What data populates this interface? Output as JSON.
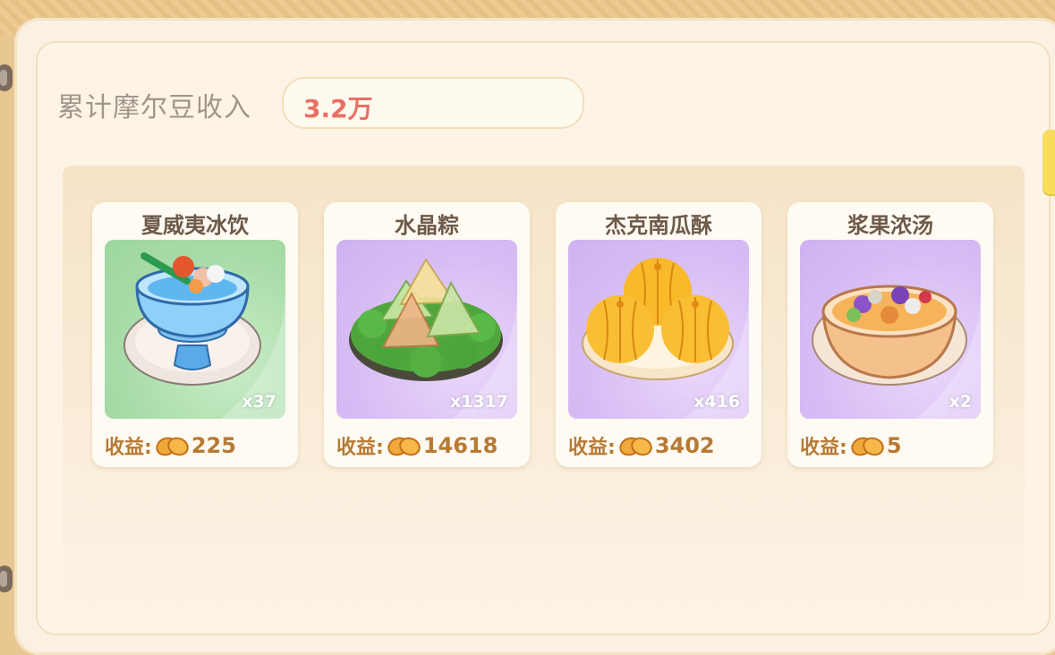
{
  "income": {
    "label": "累计摩尔豆收入",
    "value": "3.2万"
  },
  "items": [
    {
      "name": "夏威夷冰饮",
      "qty": "x37",
      "earn_label": "收益:",
      "earn": "225",
      "bg": "#a8dca9"
    },
    {
      "name": "水晶粽",
      "qty": "x1317",
      "earn_label": "收益:",
      "earn": "14618",
      "bg": "#d7bdf4"
    },
    {
      "name": "杰克南瓜酥",
      "qty": "x416",
      "earn_label": "收益:",
      "earn": "3402",
      "bg": "#d7bdf4"
    },
    {
      "name": "浆果浓汤",
      "qty": "x2",
      "earn_label": "收益:",
      "earn": "5",
      "bg": "#d7bdf4"
    }
  ],
  "icons": {
    "bean": "mole-bean-icon"
  },
  "colors": {
    "income_value": "#ea6f63",
    "earn": "#b77a33",
    "title": "#6d5a4a"
  }
}
